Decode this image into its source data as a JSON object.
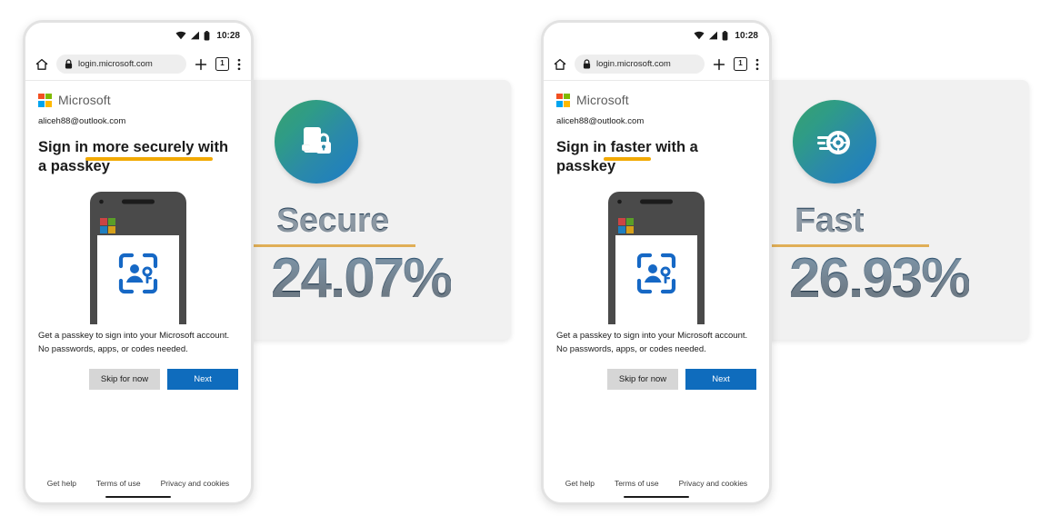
{
  "colors": {
    "accent_orange": "#f2a900",
    "rule_gold": "#e0ae56",
    "primary_blue": "#0f6cbd",
    "metric_navy": "#15293d",
    "card_bg": "#f1f1f1",
    "gradient_from": "#39a06f",
    "gradient_to": "#1c7cc6"
  },
  "panels": [
    {
      "phone": {
        "status": {
          "clock": "10:28",
          "wifi_icon": "wifi-icon",
          "signal_icon": "signal-icon",
          "battery_icon": "battery-icon"
        },
        "browser": {
          "home_icon": "home-icon",
          "lock_icon": "lock-icon",
          "url": "login.microsoft.com",
          "new_tab_icon": "plus-icon",
          "tab_count": "1",
          "menu_icon": "overflow-menu-icon"
        },
        "brand": "Microsoft",
        "account": "aliceh88@outlook.com",
        "headline": "Sign in more securely with a passkey",
        "headline_highlight": "more securely",
        "illustration_icon": "passkey-scan-icon",
        "blurb": "Get a passkey to sign into your Microsoft account. No passwords, apps, or codes needed.",
        "buttons": {
          "skip": "Skip for now",
          "next": "Next"
        },
        "footer": [
          "Get help",
          "Terms of use",
          "Privacy and cookies"
        ]
      },
      "card": {
        "icon": "phone-lock-icon",
        "label": "Secure",
        "value": "24.07%"
      }
    },
    {
      "phone": {
        "status": {
          "clock": "10:28",
          "wifi_icon": "wifi-icon",
          "signal_icon": "signal-icon",
          "battery_icon": "battery-icon"
        },
        "browser": {
          "home_icon": "home-icon",
          "lock_icon": "lock-icon",
          "url": "login.microsoft.com",
          "new_tab_icon": "plus-icon",
          "tab_count": "1",
          "menu_icon": "overflow-menu-icon"
        },
        "brand": "Microsoft",
        "account": "aliceh88@outlook.com",
        "headline": "Sign in faster with a passkey",
        "headline_highlight": "faster",
        "illustration_icon": "passkey-scan-icon",
        "blurb": "Get a passkey to sign into your Microsoft account. No passwords, apps, or codes needed.",
        "buttons": {
          "skip": "Skip for now",
          "next": "Next"
        },
        "footer": [
          "Get help",
          "Terms of use",
          "Privacy and cookies"
        ]
      },
      "card": {
        "icon": "speedometer-icon",
        "label": "Fast",
        "value": "26.93%"
      }
    }
  ]
}
